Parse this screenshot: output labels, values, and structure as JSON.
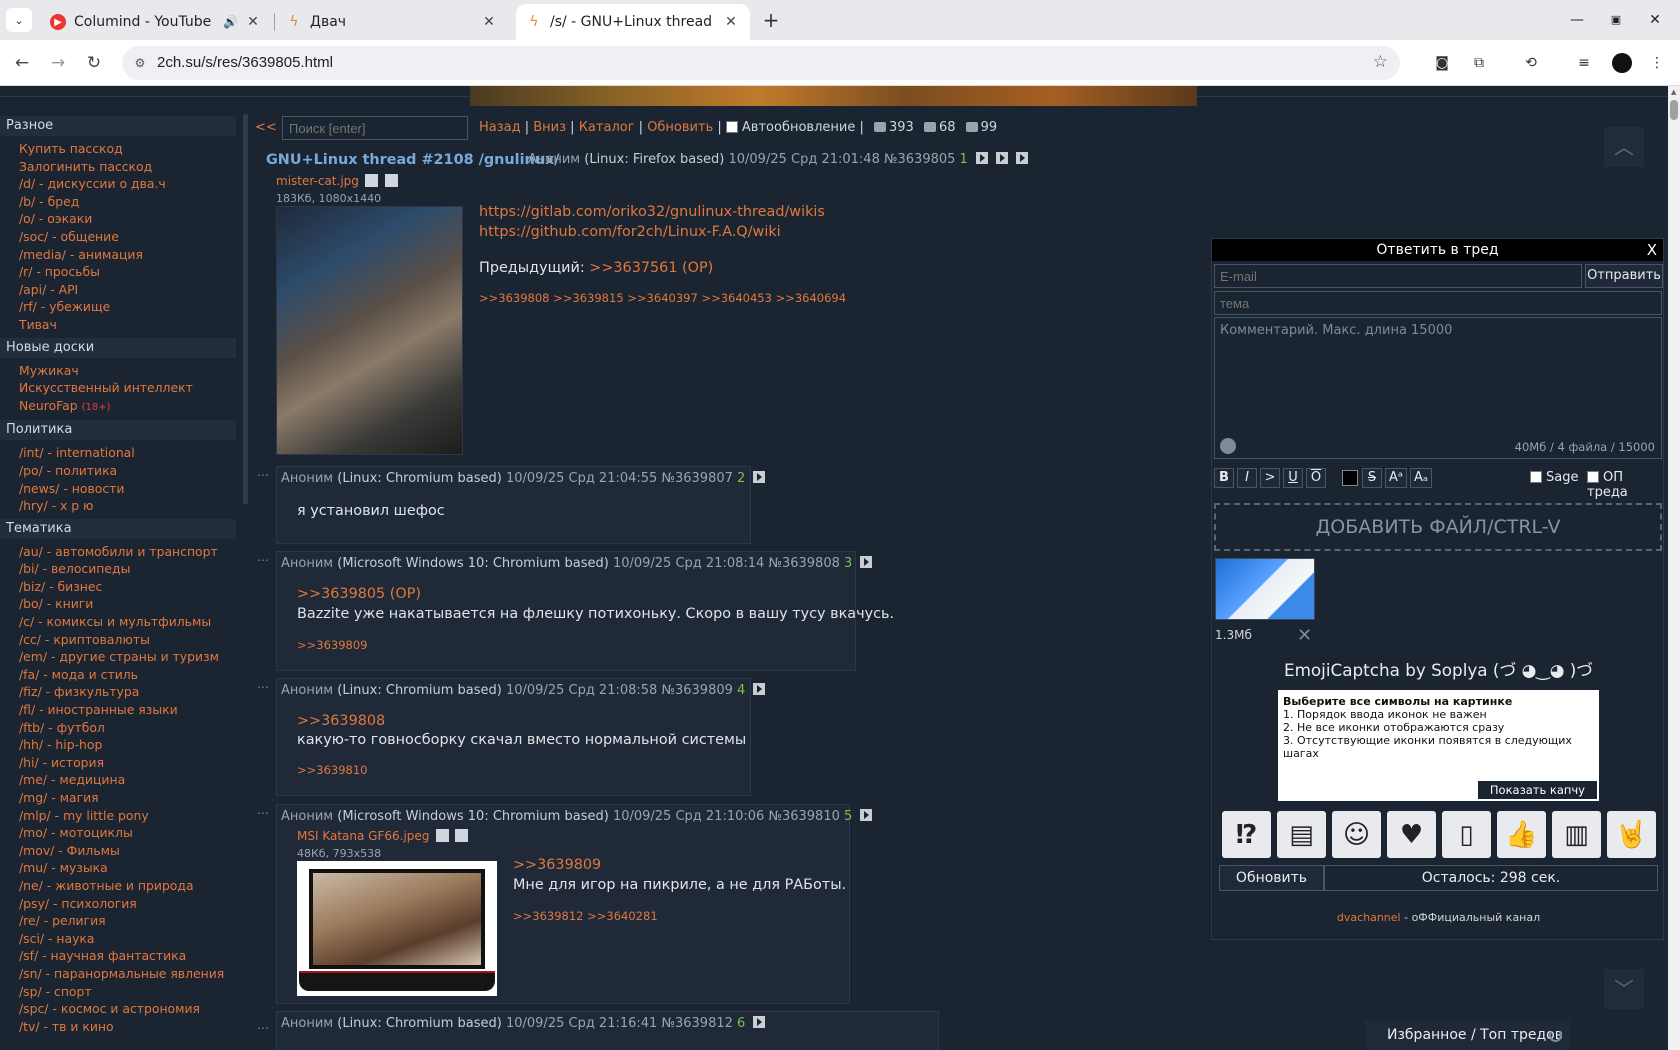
{
  "browser": {
    "tabs": [
      {
        "title": "Columind - YouTube",
        "favicon": "youtube-icon",
        "audio": true,
        "active": false
      },
      {
        "title": "Двач",
        "favicon": "2ch-icon",
        "active": false
      },
      {
        "title": "/s/ - GNU+Linux thread",
        "favicon": "2ch-icon",
        "active": true
      }
    ],
    "url": "2ch.su/s/res/3639805.html"
  },
  "sidebar": {
    "sections": [
      {
        "title": "Разное",
        "items": [
          {
            "label": "Купить пасскод"
          },
          {
            "label": "Залогинить пасскод"
          },
          {
            "label": "/d/ - дискуссии о два.ч"
          },
          {
            "label": "/b/ - бред"
          },
          {
            "label": "/o/ - оэкаки"
          },
          {
            "label": "/soc/ - общение"
          },
          {
            "label": "/media/ - анимация"
          },
          {
            "label": "/r/ - просьбы"
          },
          {
            "label": "/api/ - API"
          },
          {
            "label": "/rf/ - убежище"
          },
          {
            "label": "Тивач"
          }
        ]
      },
      {
        "title": "Новые доски",
        "items": [
          {
            "label": "Мужикач"
          },
          {
            "label": "Искусственный интеллект"
          },
          {
            "label": "NeuroFap",
            "badge": "(18+)"
          }
        ]
      },
      {
        "title": "Политика",
        "items": [
          {
            "label": "/int/ - international"
          },
          {
            "label": "/po/ - политика"
          },
          {
            "label": "/news/ - новости"
          },
          {
            "label": "/hry/ - х р ю"
          }
        ]
      },
      {
        "title": "Тематика",
        "items": [
          {
            "label": "/au/ - автомобили и транспорт"
          },
          {
            "label": "/bi/ - велосипеды"
          },
          {
            "label": "/biz/ - бизнес"
          },
          {
            "label": "/bo/ - книги"
          },
          {
            "label": "/c/ - комиксы и мультфильмы"
          },
          {
            "label": "/cc/ - криптовалюты"
          },
          {
            "label": "/em/ - другие страны и туризм"
          },
          {
            "label": "/fa/ - мода и стиль"
          },
          {
            "label": "/fiz/ - физкультура"
          },
          {
            "label": "/fl/ - иностранные языки"
          },
          {
            "label": "/ftb/ - футбол"
          },
          {
            "label": "/hh/ - hip-hop"
          },
          {
            "label": "/hi/ - история"
          },
          {
            "label": "/me/ - медицина"
          },
          {
            "label": "/mg/ - магия"
          },
          {
            "label": "/mlp/ - my little pony"
          },
          {
            "label": "/mo/ - мотоциклы"
          },
          {
            "label": "/mov/ - Фильмы"
          },
          {
            "label": "/mu/ - музыка"
          },
          {
            "label": "/ne/ - животные и природа"
          },
          {
            "label": "/psy/ - психология"
          },
          {
            "label": "/re/ - религия"
          },
          {
            "label": "/sci/ - наука"
          },
          {
            "label": "/sf/ - научная фантастика"
          },
          {
            "label": "/sn/ - паранормальные явления"
          },
          {
            "label": "/sp/ - спорт"
          },
          {
            "label": "/spc/ - космос и астрономия"
          },
          {
            "label": "/tv/ - тв и кино"
          }
        ]
      }
    ]
  },
  "topnav": {
    "collapse": "<<",
    "search_placeholder": "Поиск [enter]",
    "back": "Назад",
    "down": "Вниз",
    "catalog": "Каталог",
    "refresh": "Обновить",
    "autorefresh": "Автообновление",
    "posts_count": "393",
    "images_count": "68",
    "users_count": "99"
  },
  "op": {
    "title": "GNU+Linux thread #2108 /gnulinux/",
    "author": "Аноним",
    "agent": "(Linux: Firefox based)",
    "date": "10/09/25 Срд 21:01:48",
    "num": "№3639805",
    "index": "1",
    "file_name": "mister-cat.jpg",
    "file_info": "183Кб, 1080x1440",
    "links": [
      "https://gitlab.com/oriko32/gnulinux-thread/wikis",
      "https://github.com/for2ch/Linux-F.A.Q/wiki"
    ],
    "prev_label": "Предыдущий:",
    "prev_link": ">>3637561 (OP)",
    "replies": ">>3639808 >>3639815 >>3640397 >>3640453 >>3640694"
  },
  "posts": [
    {
      "author": "Аноним",
      "agent": "(Linux: Chromium based)",
      "date": "10/09/25 Срд 21:04:55",
      "num": "№3639807",
      "index": "2",
      "text": "я установил шефос"
    },
    {
      "author": "Аноним",
      "agent": "(Microsoft Windows 10: Chromium based)",
      "date": "10/09/25 Срд 21:08:14",
      "num": "№3639808",
      "index": "3",
      "quote": ">>3639805 (OP)",
      "text": "Bazzite уже накатывается на флешку потихоньку. Скоро в вашу тусу вкачусь.",
      "replies": ">>3639809"
    },
    {
      "author": "Аноним",
      "agent": "(Linux: Chromium based)",
      "date": "10/09/25 Срд 21:08:58",
      "num": "№3639809",
      "index": "4",
      "quote": ">>3639808",
      "text": "какую-то говносборку скачал вместо нормальной системы",
      "replies": ">>3639810"
    },
    {
      "author": "Аноним",
      "agent": "(Microsoft Windows 10: Chromium based)",
      "date": "10/09/25 Срд 21:10:06",
      "num": "№3639810",
      "index": "5",
      "file_name": "MSI Katana GF66.jpeg",
      "file_info": "48Кб, 793x538",
      "quote": ">>3639809",
      "text": "Мне для игор на пикриле, а не для РАБоты.",
      "replies": ">>3639812 >>3640281"
    },
    {
      "author": "Аноним",
      "agent": "(Linux: Chromium based)",
      "date": "10/09/25 Срд 21:16:41",
      "num": "№3639812",
      "index": "6"
    }
  ],
  "reply_form": {
    "title": "Ответить в тред",
    "close": "X",
    "email_placeholder": "E-mail",
    "send": "Отправить",
    "subject_placeholder": "тема",
    "comment_placeholder": "Комментарий. Макс. длина 15000",
    "limit": "40Мб / 4 файла / 15000",
    "format_buttons": [
      "B",
      "I",
      ">",
      "U",
      "O",
      "S"
    ],
    "sup": "Aᵃ",
    "sub": "Aₐ",
    "sage": "Sage",
    "op_thread": "ОП треда",
    "drop": "ДОБАВИТЬ ФАЙЛ/CTRL-V",
    "attached_size": "1.3Мб",
    "captcha_title": "EmojiCaptcha by Soplya (づ ◕‿◕ )づ",
    "captcha_heading": "Выберите все символы на картинке",
    "captcha_rules": [
      "1. Порядок ввода иконок не важен",
      "2. Не все иконки отображаются сразу",
      "3. Отсутствующие иконки появятся в следующих шагах"
    ],
    "captcha_show": "Показать капчу",
    "captcha_icons": [
      "⁉",
      "▤",
      "☺",
      "♥",
      "▯",
      "👍",
      "▥",
      "🤘"
    ],
    "refresh": "Обновить",
    "remaining": "Осталось: 298 сек.",
    "footer_link": "dvachannel",
    "footer_text": " - оФФициальный канал"
  },
  "favorites": "Избранное / Топ тредов"
}
